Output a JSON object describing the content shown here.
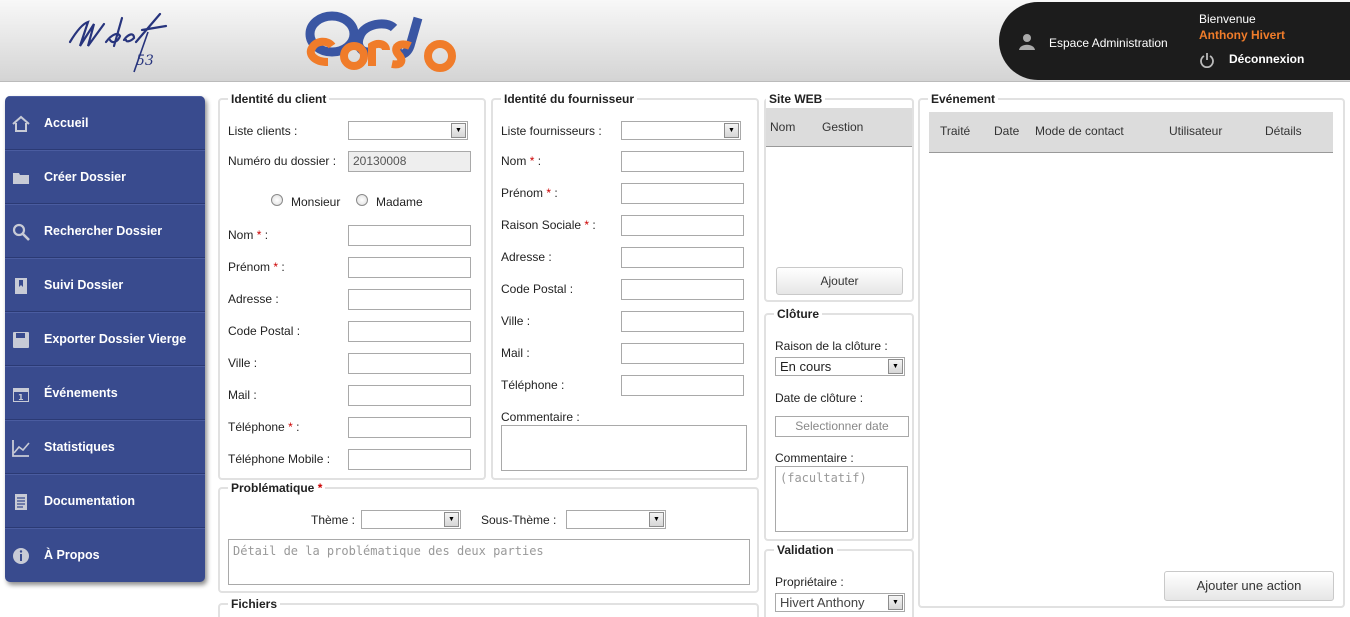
{
  "header": {
    "logo_mdaf_num": "53",
    "admin_link": "Espace Administration",
    "welcome": "Bienvenue",
    "user_name": "Anthony Hivert",
    "logout": "Déconnexion",
    "colors": {
      "brand_blue": "#3a56a3",
      "brand_orange": "#f07c2a",
      "user_orange": "#f07c2a"
    }
  },
  "sidebar": {
    "items": [
      {
        "label": "Accueil",
        "icon": "home-icon"
      },
      {
        "label": "Créer Dossier",
        "icon": "folder-icon"
      },
      {
        "label": "Rechercher Dossier",
        "icon": "search-icon"
      },
      {
        "label": "Suivi Dossier",
        "icon": "bookmark-icon"
      },
      {
        "label": "Exporter Dossier Vierge",
        "icon": "save-icon"
      },
      {
        "label": "Événements",
        "icon": "calendar-icon"
      },
      {
        "label": "Statistiques",
        "icon": "chart-icon"
      },
      {
        "label": "Documentation",
        "icon": "document-icon"
      },
      {
        "label": "À Propos",
        "icon": "info-icon"
      }
    ]
  },
  "client": {
    "legend": "Identité du client",
    "liste_clients": "Liste clients :",
    "numero_dossier": "Numéro du dossier :",
    "numero_dossier_value": "20130008",
    "monsieur": "Monsieur",
    "madame": "Madame",
    "nom": "Nom",
    "prenom": "Prénom",
    "adresse": "Adresse :",
    "code_postal": "Code Postal :",
    "ville": "Ville :",
    "mail": "Mail :",
    "telephone": "Téléphone",
    "telephone_mobile": "Téléphone Mobile :"
  },
  "fournisseur": {
    "legend": "Identité du fournisseur",
    "liste_fournisseurs": "Liste fournisseurs :",
    "nom": "Nom",
    "prenom": "Prénom",
    "raison_sociale": "Raison Sociale",
    "adresse": "Adresse :",
    "code_postal": "Code Postal :",
    "ville": "Ville :",
    "mail": "Mail :",
    "telephone": "Téléphone :",
    "commentaire": "Commentaire :"
  },
  "probleme": {
    "legend": "Problématique",
    "theme": "Thème :",
    "sous_theme": "Sous-Thème :",
    "detail_placeholder": "Détail de la problématique des deux parties"
  },
  "fichiers": {
    "legend": "Fichiers"
  },
  "site_web": {
    "legend": "Site WEB",
    "col_nom": "Nom",
    "col_gestion": "Gestion",
    "ajouter": "Ajouter"
  },
  "cloture": {
    "legend": "Clôture",
    "raison": "Raison de la clôture :",
    "raison_value": "En cours",
    "date": "Date de clôture :",
    "date_placeholder": "Selectionner date",
    "commentaire": "Commentaire :",
    "commentaire_placeholder": "(facultatif)"
  },
  "validation": {
    "legend": "Validation",
    "proprietaire": "Propriétaire :",
    "proprietaire_value": "Hivert Anthony"
  },
  "evenement": {
    "legend": "Evénement",
    "columns": [
      "Traité",
      "Date",
      "Mode de contact",
      "Utilisateur",
      "Détails"
    ],
    "ajouter": "Ajouter une action"
  },
  "required_mark": "*"
}
